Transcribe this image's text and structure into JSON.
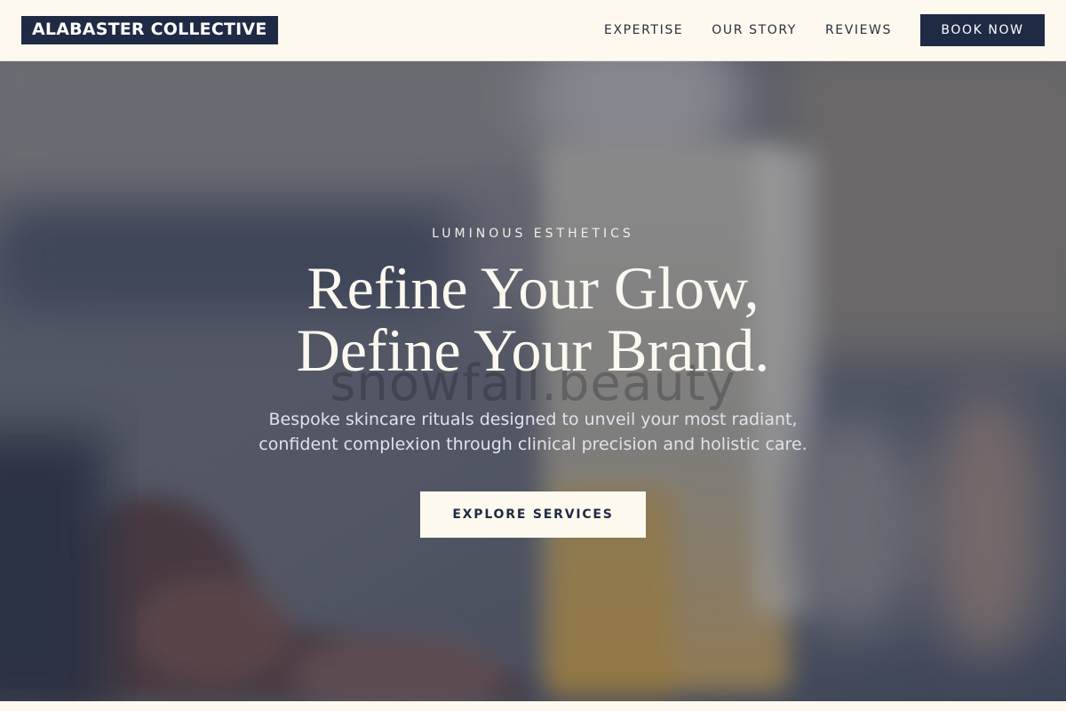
{
  "header": {
    "logo": "ALABASTER COLLECTIVE",
    "nav": [
      {
        "label": "EXPERTISE"
      },
      {
        "label": "OUR STORY"
      },
      {
        "label": "REVIEWS"
      }
    ],
    "cta_label": "BOOK NOW"
  },
  "hero": {
    "eyebrow": "LUMINOUS ESTHETICS",
    "headline_line1": "Refine Your Glow,",
    "headline_line2": "Define Your Brand.",
    "subcopy_line1": "Bespoke skincare rituals designed to unveil your most radiant,",
    "subcopy_line2": "confident complexion through clinical precision and holistic care.",
    "cta_label": "EXPLORE SERVICES",
    "watermark": "snowfall.beauty",
    "background": "blurred photo of a hand holding a skincare product"
  },
  "colors": {
    "brand_navy": "#1f2a44",
    "cream": "#fdf9ef",
    "overlay": "#1e2434"
  }
}
